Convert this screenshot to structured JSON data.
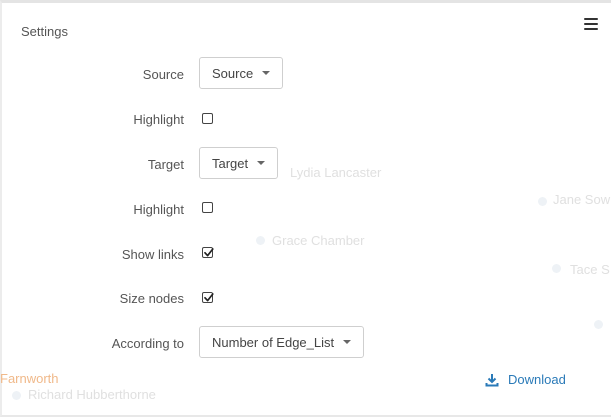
{
  "panel": {
    "title": "Settings"
  },
  "form": {
    "source_label": "Source",
    "source_value": "Source",
    "highlight_source_label": "Highlight",
    "highlight_source_checked": false,
    "target_label": "Target",
    "target_value": "Target",
    "highlight_target_label": "Highlight",
    "highlight_target_checked": false,
    "show_links_label": "Show links",
    "show_links_checked": true,
    "size_nodes_label": "Size nodes",
    "size_nodes_checked": true,
    "according_label": "According to",
    "according_value": "Number of Edge_List"
  },
  "actions": {
    "download_label": "Download"
  },
  "graph_labels": {
    "lydia": "Lydia Lancaster",
    "jane": "Jane Sow",
    "grace": "Grace Chamber",
    "tace": "Tace S",
    "farnworth": "Farnworth",
    "richard": "Richard Hubberthorne"
  },
  "colors": {
    "accent": "#2a7ab8",
    "node_label_orange": "#f0b98a"
  },
  "icons": {
    "menu": "hamburger-menu-icon",
    "download": "download-icon",
    "caret": "caret-down-icon",
    "check": "checkmark-icon"
  }
}
